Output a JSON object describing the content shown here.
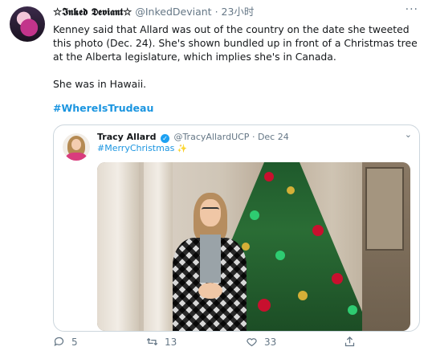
{
  "tweet": {
    "display_name": "☆𝕴𝖓𝖐𝖊𝖉 𝕯𝖊𝖛𝖎𝖆𝖓𝖙☆",
    "handle": "@InkedDeviant",
    "separator": "·",
    "time": "23小时",
    "more_icon": "···",
    "paragraph1": "Kenney said that Allard was out of the country on the date she tweeted this photo (Dec. 24). She's shown bundled up in front of a Christmas tree at the Alberta legislature, which implies she's in Canada.",
    "paragraph2": "She was in Hawaii.",
    "hashtag": "#WhereIsTrudeau"
  },
  "quoted": {
    "name": "Tracy Allard",
    "verified_icon": "✓",
    "handle": "@TracyAllardUCP",
    "separator": "·",
    "date": "Dec 24",
    "hashtag": "#MerryChristmas",
    "sparkle_icon": "✨",
    "chevron_icon": "⌄"
  },
  "actions": {
    "reply_count": "5",
    "retweet_count": "13",
    "like_count": "33"
  },
  "colors": {
    "link": "#1b95e0",
    "muted": "#657786",
    "verified": "#1da1f2",
    "border": "#ccd6dd"
  }
}
